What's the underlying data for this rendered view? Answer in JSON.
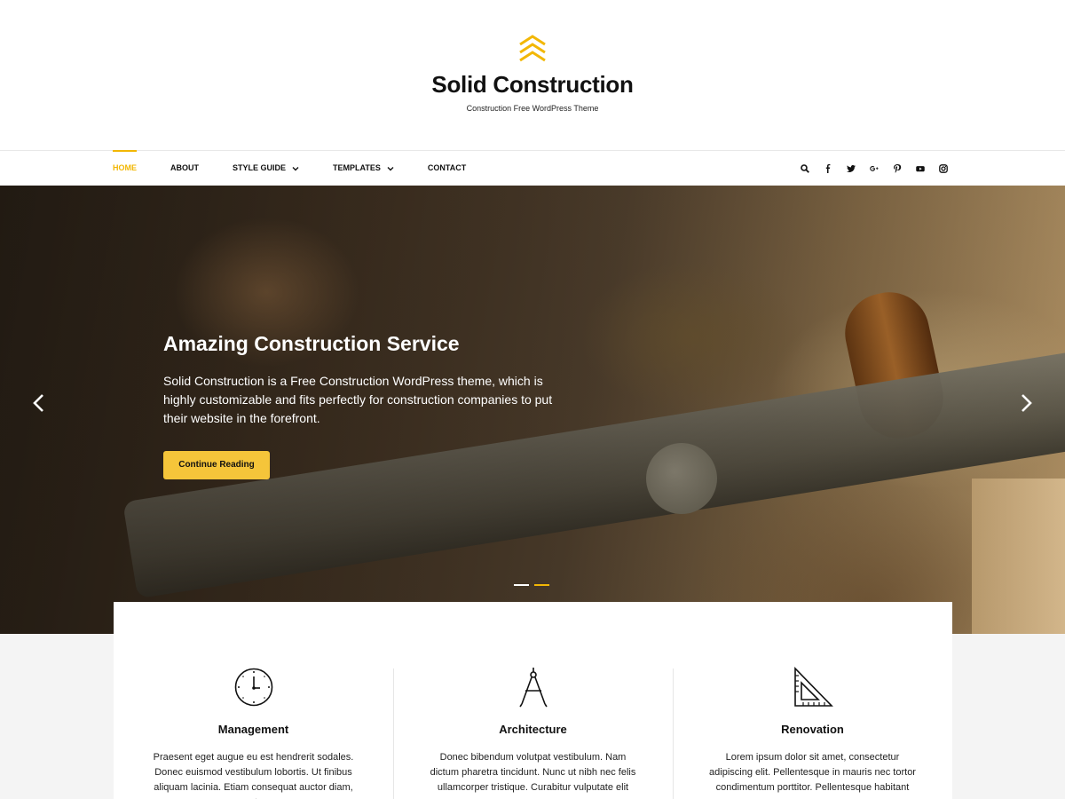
{
  "brand": {
    "title": "Solid Construction",
    "tagline": "Construction Free WordPress Theme",
    "accent": "#f2b705"
  },
  "nav": {
    "items": [
      {
        "label": "HOME",
        "active": true
      },
      {
        "label": "ABOUT"
      },
      {
        "label": "STYLE GUIDE",
        "dropdown": true
      },
      {
        "label": "TEMPLATES",
        "dropdown": true
      },
      {
        "label": "CONTACT"
      }
    ],
    "icons": [
      "search-icon",
      "facebook-icon",
      "twitter-icon",
      "google-plus-icon",
      "pinterest-icon",
      "youtube-icon",
      "instagram-icon"
    ]
  },
  "hero": {
    "title": "Amazing Construction Service",
    "text": "Solid Construction is a Free Construction WordPress theme, which is highly customizable and fits perfectly for construction companies to put their website in the forefront.",
    "button": "Continue Reading",
    "slides": 2,
    "active_slide": 2
  },
  "services": [
    {
      "icon": "clock-icon",
      "title": "Management",
      "text": "Praesent eget augue eu est hendrerit sodales. Donec euismod vestibulum lobortis. Ut finibus aliquam lacinia. Etiam consequat auctor diam, et"
    },
    {
      "icon": "compass-icon",
      "title": "Architecture",
      "text": "Donec bibendum volutpat vestibulum. Nam dictum pharetra tincidunt. Nunc ut nibh nec felis ullamcorper tristique. Curabitur vulputate elit"
    },
    {
      "icon": "set-square-icon",
      "title": "Renovation",
      "text": "Lorem ipsum dolor sit amet, consectetur adipiscing elit. Pellentesque in mauris nec tortor condimentum porttitor. Pellentesque habitant"
    }
  ]
}
